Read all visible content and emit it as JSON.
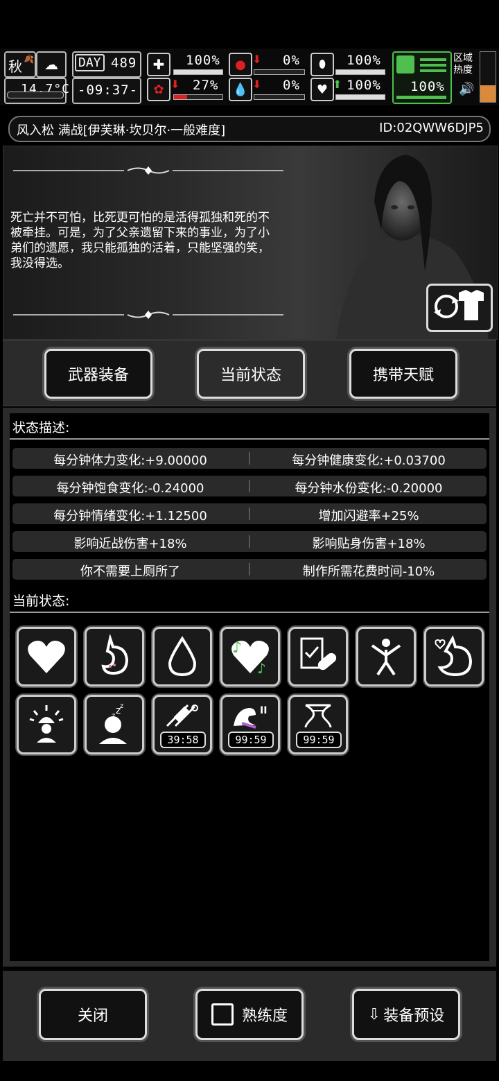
{
  "hud": {
    "season": "秋",
    "temperature": "14.7°C",
    "day_label": "DAY",
    "day_number": "489",
    "clock": "-09:37-",
    "stats": [
      {
        "name": "medical",
        "value": "100%",
        "level": 1.0
      },
      {
        "name": "hunger",
        "value": "0%",
        "level": 0.0
      },
      {
        "name": "stamina",
        "value": "100%",
        "level": 1.0
      },
      {
        "name": "brain",
        "value": "27%",
        "level": 0.27
      },
      {
        "name": "blood",
        "value": "0%",
        "level": 0.0
      },
      {
        "name": "health",
        "value": "100%",
        "level": 1.0
      }
    ],
    "energy_value": "100%",
    "zone_label": "区域\n热度",
    "zone_line1": "区域",
    "zone_line2": "热度"
  },
  "header": {
    "title": "风入松 满战[伊芙琳·坎贝尔·一般难度]",
    "id": "ID:02QWW6DJP5"
  },
  "portrait": {
    "quote": "死亡并不可怕，比死更可怕的是活得孤独和死的不被牵挂。可是，为了父亲遗留下来的事业，为了小弟们的遗愿，我只能孤独的活着，只能坚强的笑，我没得选。"
  },
  "tabs": [
    {
      "label": "武器装备"
    },
    {
      "label": "当前状态"
    },
    {
      "label": "携带天赋"
    }
  ],
  "status": {
    "desc_heading": "状态描述:",
    "rows": [
      [
        "每分钟体力变化:+9.00000",
        "每分钟健康变化:+0.03700"
      ],
      [
        "每分钟饱食变化:-0.24000",
        "每分钟水份变化:-0.20000"
      ],
      [
        "每分钟情绪变化:+1.12500",
        "增加闪避率+25%"
      ],
      [
        "影响近战伤害+18%",
        "影响贴身伤害+18%"
      ],
      [
        "你不需要上厕所了",
        "制作所需花费时间-10%"
      ]
    ],
    "current_heading": "当前状态:",
    "timers": [
      "39:58",
      "99:59",
      "99:59"
    ]
  },
  "footer": {
    "close": "关闭",
    "proficiency": "熟练度",
    "preset": "装备预设"
  },
  "colors": {
    "accent_green": "#4fc04f",
    "warn_red": "#e02020",
    "panel_gray": "#2b2b2b"
  }
}
